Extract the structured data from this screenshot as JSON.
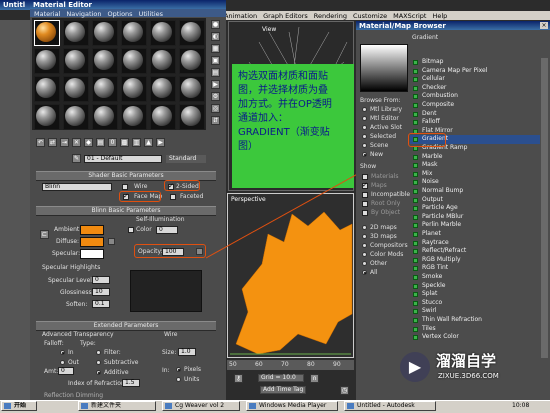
{
  "outer_window": {
    "menu": [
      "Animation",
      "Graph Editors",
      "Rendering",
      "Customize",
      "MAXScript",
      "Help"
    ],
    "title_left": "Untitl"
  },
  "material_editor": {
    "title": "Material Editor",
    "menu": [
      "Material",
      "Navigation",
      "Options",
      "Utilities"
    ],
    "material_name": "01 - Default",
    "material_type": "Standard",
    "shader_rollout": "Shader Basic Parameters",
    "shader": "Blinn",
    "wire": "Wire",
    "two_sided": "2-Sided",
    "face_map": "Face Map",
    "faceted": "Faceted",
    "blinn_rollout": "Blinn Basic Parameters",
    "self_illum": "Self-Illumination",
    "color_label": "Color",
    "color_value": "0",
    "ambient": "Ambient:",
    "diffuse": "Diffuse:",
    "specular": "Specular:",
    "opacity_label": "Opacity:",
    "opacity_value": "100",
    "spec_highlights": "Specular Highlights",
    "spec_level": "Specular Level:",
    "spec_level_value": "0",
    "glossiness": "Glossiness:",
    "glossiness_value": "10",
    "soften": "Soften:",
    "soften_value": "0.1",
    "extended_rollout": "Extended Parameters",
    "adv_transparency": "Advanced Transparency",
    "falloff": "Falloff:",
    "type": "Type:",
    "in": "In",
    "out": "Out",
    "amt": "Amt:",
    "amt_value": "0",
    "filter": "Filter:",
    "subtractive": "Subtractive",
    "additive": "Additive",
    "ior": "Index of Refraction:",
    "ior_value": "1.5",
    "wire_label": "Wire",
    "size": "Size:",
    "size_value": "1.0",
    "in_label": "In:",
    "pixels": "Pixels",
    "units": "Units",
    "reflection_dimming": "Reflection Dimming"
  },
  "viewport": {
    "label_top": "View",
    "label_perspective": "Perspective",
    "ruler": [
      "50",
      "60",
      "70",
      "80",
      "90"
    ],
    "grid": "Grid = 10.0",
    "add_time_tag": "Add Time Tag"
  },
  "annotation": "构选双面材质和面贴图，并选择材质为叠加方式。并在OP透明通道加入：GRADIENT（渐变贴图）",
  "browser": {
    "title": "Material/Map Browser",
    "preview_label": "Gradient",
    "browse_from": "Browse From:",
    "browse_options": [
      {
        "label": "Mtl Library",
        "on": false
      },
      {
        "label": "Mtl Editor",
        "on": false
      },
      {
        "label": "Active Slot",
        "on": false
      },
      {
        "label": "Selected",
        "on": false
      },
      {
        "label": "Scene",
        "on": false
      },
      {
        "label": "New",
        "on": true
      }
    ],
    "show": "Show",
    "show_checks": [
      "Materials",
      "Maps",
      "Incompatible"
    ],
    "root_only": "Root Only",
    "by_object": "By Object",
    "map_types": [
      {
        "label": "2D maps",
        "on": false
      },
      {
        "label": "3D maps",
        "on": false
      },
      {
        "label": "Compositors",
        "on": false
      },
      {
        "label": "Color Mods",
        "on": false
      },
      {
        "label": "Other",
        "on": false
      },
      {
        "label": "All",
        "on": true
      }
    ],
    "maps": [
      "Bitmap",
      "Camera Map Per Pixel",
      "Cellular",
      "Checker",
      "Combustion",
      "Composite",
      "Dent",
      "Falloff",
      "Flat Mirror",
      "Gradient",
      "Gradient Ramp",
      "Marble",
      "Mask",
      "Mix",
      "Noise",
      "Normal Bump",
      "Output",
      "Particle Age",
      "Particle MBlur",
      "Perlin Marble",
      "Planet",
      "Raytrace",
      "Reflect/Refract",
      "RGB Multiply",
      "RGB Tint",
      "Smoke",
      "Speckle",
      "Splat",
      "Stucco",
      "Swirl",
      "Thin Wall Refraction",
      "Tiles",
      "Vertex Color"
    ],
    "selected": "Gradient"
  },
  "watermark": {
    "cn": "溜溜自学",
    "url": "ZIXUE.3D66.COM"
  },
  "taskbar": {
    "start": "开始",
    "tasks": [
      "新建文件夹",
      "Cg Weaver vol 2",
      "Windows Media Player",
      "Untitled - Autodesk"
    ],
    "clock": "10:08"
  },
  "colors": {
    "ambient": "#f08a10",
    "diffuse": "#f08a10",
    "specular": "#ffffff",
    "annotation_bg": "#3cc83c",
    "annotation_text": "#0a1a8a",
    "highlight": "#e05010"
  }
}
